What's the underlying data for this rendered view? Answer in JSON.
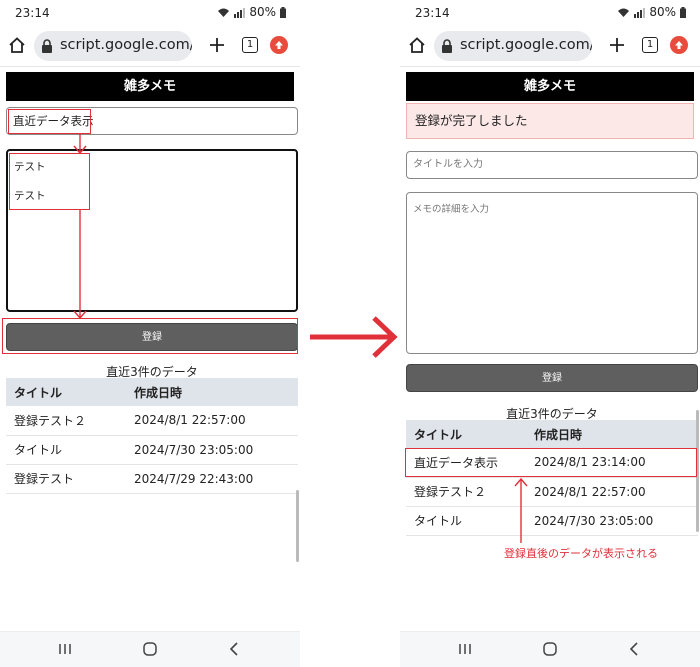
{
  "status_bar": {
    "time": "23:14",
    "battery": "80%"
  },
  "browser": {
    "url": "script.google.com/ma",
    "tab_count": "1"
  },
  "app": {
    "header_title": "雑多メモ",
    "register_label": "登録",
    "recent_title": "直近3件のデータ"
  },
  "left": {
    "title_value": "直近データ表示",
    "memo_lines": [
      "テスト",
      "テスト"
    ],
    "table": {
      "headers": [
        "タイトル",
        "作成日時"
      ],
      "rows": [
        [
          "登録テスト２",
          "2024/8/1 22:57:00"
        ],
        [
          "タイトル",
          "2024/7/30 23:05:00"
        ],
        [
          "登録テスト",
          "2024/7/29 22:43:00"
        ]
      ]
    }
  },
  "right": {
    "banner": "登録が完了しました",
    "title_placeholder": "タイトルを入力",
    "memo_placeholder": "メモの詳細を入力",
    "table": {
      "headers": [
        "タイトル",
        "作成日時"
      ],
      "rows": [
        [
          "直近データ表示",
          "2024/8/1 23:14:00"
        ],
        [
          "登録テスト２",
          "2024/8/1 22:57:00"
        ],
        [
          "タイトル",
          "2024/7/30 23:05:00"
        ]
      ]
    },
    "annotation": "登録直後のデータが表示される"
  },
  "colors": {
    "annotation": "#e0303a",
    "header_bg": "#000000",
    "button_bg": "#5f5f5f",
    "table_header_bg": "#dfe3ea",
    "banner_bg": "#fde8e8"
  }
}
